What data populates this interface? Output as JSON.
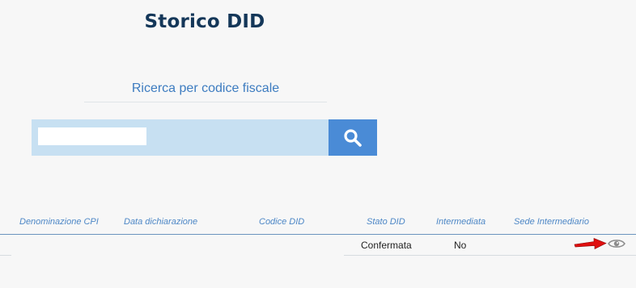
{
  "page": {
    "title": "Storico DID"
  },
  "search": {
    "label": "Ricerca per codice fiscale",
    "value": "",
    "placeholder": "",
    "button_icon": "search-icon"
  },
  "table": {
    "headers": {
      "denominazione_cpi": "Denominazione CPI",
      "data_dichiarazione": "Data dichiarazione",
      "codice_did": "Codice DID",
      "stato_did": "Stato DID",
      "intermediata": "Intermediata",
      "sede_intermediario": "Sede Intermediario"
    },
    "rows": [
      {
        "denominazione_cpi": "",
        "data_dichiarazione": "",
        "codice_did": "",
        "stato_did": "Confermata",
        "intermediata": "No",
        "sede_intermediario": "",
        "action_icon": "eye-icon"
      }
    ]
  },
  "colors": {
    "title": "#143759",
    "accent": "#3d7cc0",
    "search_field": "#c7e0f2",
    "search_button": "#4a8bd6",
    "annotation_arrow": "#e01010"
  }
}
